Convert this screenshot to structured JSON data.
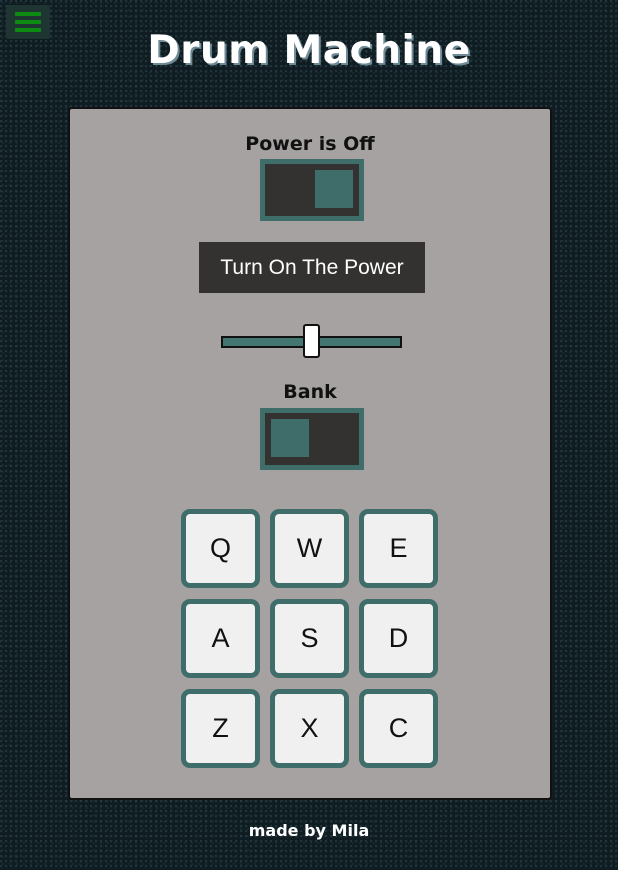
{
  "header": {
    "menu_icon": "hamburger-menu-icon",
    "title": "Drum Machine"
  },
  "controls": {
    "power": {
      "label": "Power is Off",
      "state": "off"
    },
    "display_text": "Turn On The Power",
    "volume": {
      "level": 0.5
    },
    "bank": {
      "label": "Bank",
      "state": "off"
    }
  },
  "pads": [
    {
      "key": "Q"
    },
    {
      "key": "W"
    },
    {
      "key": "E"
    },
    {
      "key": "A"
    },
    {
      "key": "S"
    },
    {
      "key": "D"
    },
    {
      "key": "Z"
    },
    {
      "key": "X"
    },
    {
      "key": "C"
    }
  ],
  "footer": {
    "credit": "made by Mila"
  },
  "colors": {
    "page_background": "#0f1d22",
    "panel_background": "#a5a2a1",
    "accent_teal": "#3f6d69",
    "control_dark": "#333231",
    "menu_green": "#0c8a12"
  }
}
